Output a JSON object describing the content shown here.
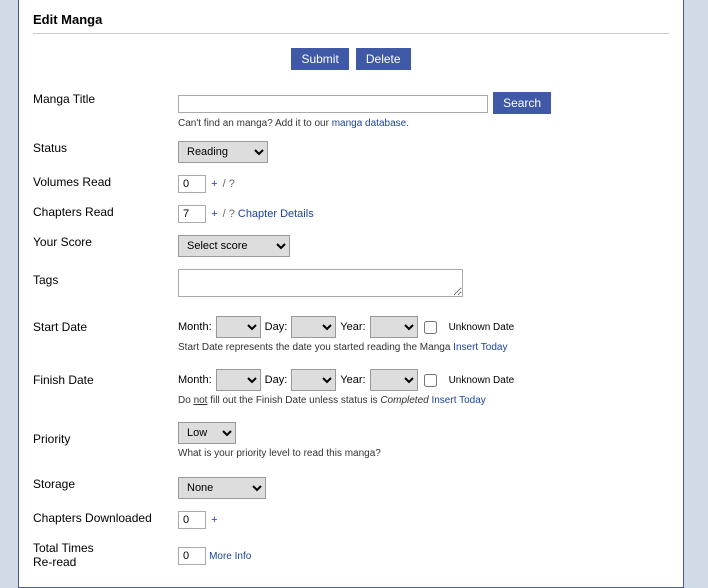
{
  "page": {
    "title": "Edit Manga"
  },
  "actions": {
    "submit": "Submit",
    "delete": "Delete"
  },
  "title": {
    "label": "Manga Title",
    "value": "",
    "search": "Search",
    "hint_prefix": "Can't find an manga? Add it to our ",
    "hint_link": "manga database",
    "hint_suffix": "."
  },
  "status": {
    "label": "Status",
    "value": "Reading"
  },
  "volumes": {
    "label": "Volumes Read",
    "value": "0",
    "plus": "+",
    "sep": "/",
    "total": "?"
  },
  "chapters": {
    "label": "Chapters Read",
    "value": "7",
    "plus": "+",
    "sep": "/",
    "total": "?",
    "details": "Chapter Details"
  },
  "score": {
    "label": "Your Score",
    "value": "Select score"
  },
  "tags": {
    "label": "Tags",
    "value": ""
  },
  "start_date": {
    "label": "Start Date",
    "month_lbl": "Month:",
    "day_lbl": "Day:",
    "year_lbl": "Year:",
    "unknown": "Unknown Date",
    "hint": "Start Date represents the date you started reading the Manga ",
    "insert": "Insert Today"
  },
  "finish_date": {
    "label": "Finish Date",
    "month_lbl": "Month:",
    "day_lbl": "Day:",
    "year_lbl": "Year:",
    "unknown": "Unknown Date",
    "hint_prefix": "Do ",
    "hint_not": "not",
    "hint_mid": " fill out the Finish Date unless status is ",
    "hint_completed": "Completed",
    "hint_space": " ",
    "insert": "Insert Today"
  },
  "priority": {
    "label": "Priority",
    "value": "Low",
    "hint": "What is your priority level to read this manga?"
  },
  "storage": {
    "label": "Storage",
    "value": "None"
  },
  "downloaded": {
    "label": "Chapters Downloaded",
    "value": "0",
    "plus": "+"
  },
  "reread": {
    "label": "Total Times\nRe-read",
    "label1": "Total Times",
    "label2": "Re-read",
    "value": "0",
    "more": "More Info"
  }
}
